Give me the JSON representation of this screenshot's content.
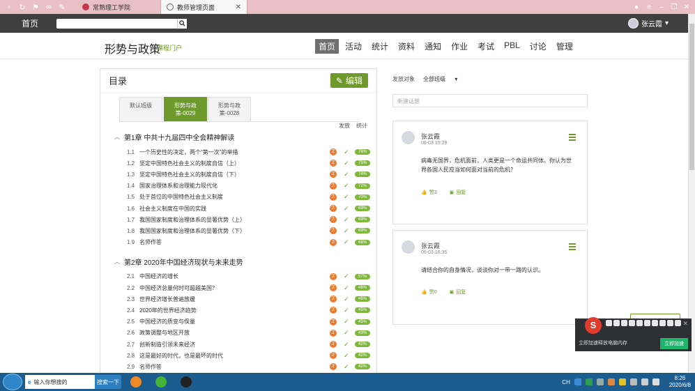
{
  "browser": {
    "tabs": [
      {
        "title": "常熟理工学院"
      },
      {
        "title": "教师管理页面"
      }
    ]
  },
  "topnav": {
    "home": "首页",
    "user": "张云霞"
  },
  "course": {
    "title": "形势与政策",
    "subtitle": "课程门户",
    "menu": [
      "首页",
      "活动",
      "统计",
      "资料",
      "通知",
      "作业",
      "考试",
      "PBL",
      "讨论",
      "管理"
    ]
  },
  "catalog": {
    "title": "目录",
    "edit_label": "编辑",
    "class_tabs": [
      "默认班级",
      "形势与政策-0029",
      "形势与政策-0028"
    ],
    "col_publish": "发放",
    "col_stats": "统计",
    "chapters": [
      {
        "title": "第1章 中共十九届四中全会精神解读",
        "sections": [
          {
            "num": "1.1",
            "name": "一个历史性的决定，两个“第一次”的举措",
            "count": "2",
            "stat": "76%"
          },
          {
            "num": "1.2",
            "name": "坚定中国特色社会主义的制度自信（上）",
            "count": "2",
            "stat": "75%"
          },
          {
            "num": "1.3",
            "name": "坚定中国特色社会主义的制度自信（下）",
            "count": "2",
            "stat": "74%"
          },
          {
            "num": "1.4",
            "name": "国家治理体系和治理能力现代化",
            "count": "2",
            "stat": "72%"
          },
          {
            "num": "1.5",
            "name": "处于首位的中国特色社会主义制度",
            "count": "2",
            "stat": "70%"
          },
          {
            "num": "1.6",
            "name": "社会主义制度在中国的实践",
            "count": "2",
            "stat": "69%"
          },
          {
            "num": "1.7",
            "name": "我国国家制度和治理体系的显著优势（上）",
            "count": "2",
            "stat": "69%"
          },
          {
            "num": "1.8",
            "name": "我国国家制度和治理体系的显著优势（下）",
            "count": "2",
            "stat": "69%"
          },
          {
            "num": "1.9",
            "name": "名师作答",
            "count": "2",
            "stat": "68%"
          }
        ]
      },
      {
        "title": "第2章 2020年中国经济现状与未来走势",
        "sections": [
          {
            "num": "2.1",
            "name": "中国经济的增长",
            "count": "2",
            "stat": "57%"
          },
          {
            "num": "2.2",
            "name": "中国经济总量何时可超越美国？",
            "count": "2",
            "stat": "48%"
          },
          {
            "num": "2.3",
            "name": "世界经济增长普遍放缓",
            "count": "2",
            "stat": "46%"
          },
          {
            "num": "2.4",
            "name": "2020年的世界经济趋势",
            "count": "2",
            "stat": "45%"
          },
          {
            "num": "2.5",
            "name": "中国经济的质变与保量",
            "count": "2",
            "stat": "45%"
          },
          {
            "num": "2.6",
            "name": "政策调整与地区开放",
            "count": "2",
            "stat": "43%"
          },
          {
            "num": "2.7",
            "name": "创新制造引领未来经济",
            "count": "2",
            "stat": "42%"
          },
          {
            "num": "2.8",
            "name": "这是最好的时代，也是最坏的时代",
            "count": "2",
            "stat": "42%"
          },
          {
            "num": "2.9",
            "name": "名师作答",
            "count": "2",
            "stat": "42%"
          }
        ]
      }
    ]
  },
  "discussion": {
    "filter_label": "发放对象",
    "filter_value": "全部班级",
    "new_topic_placeholder": "新建话题",
    "posts": [
      {
        "author": "张云霞",
        "time": "06-03 15:28",
        "content": "病毒无国界，危机面前，人类更是一个命运共同体。你认为世界各国人民应当如何面对当前的危机？",
        "likes": "赞3",
        "reply": "回复"
      },
      {
        "author": "张云霞",
        "time": "06-03 16:35",
        "content": "请结合你的自身情况，谈谈你对一带一路的认识。",
        "likes": "赞0",
        "reply": "回复"
      }
    ]
  },
  "popup": {
    "message": "立即加速释放电脑内存",
    "button": "立即加速"
  },
  "taskbar": {
    "search_text": "输入你想搜的",
    "search_button": "搜索一下",
    "ime": "CH",
    "time": "8:26",
    "date": "2020/6/8"
  }
}
